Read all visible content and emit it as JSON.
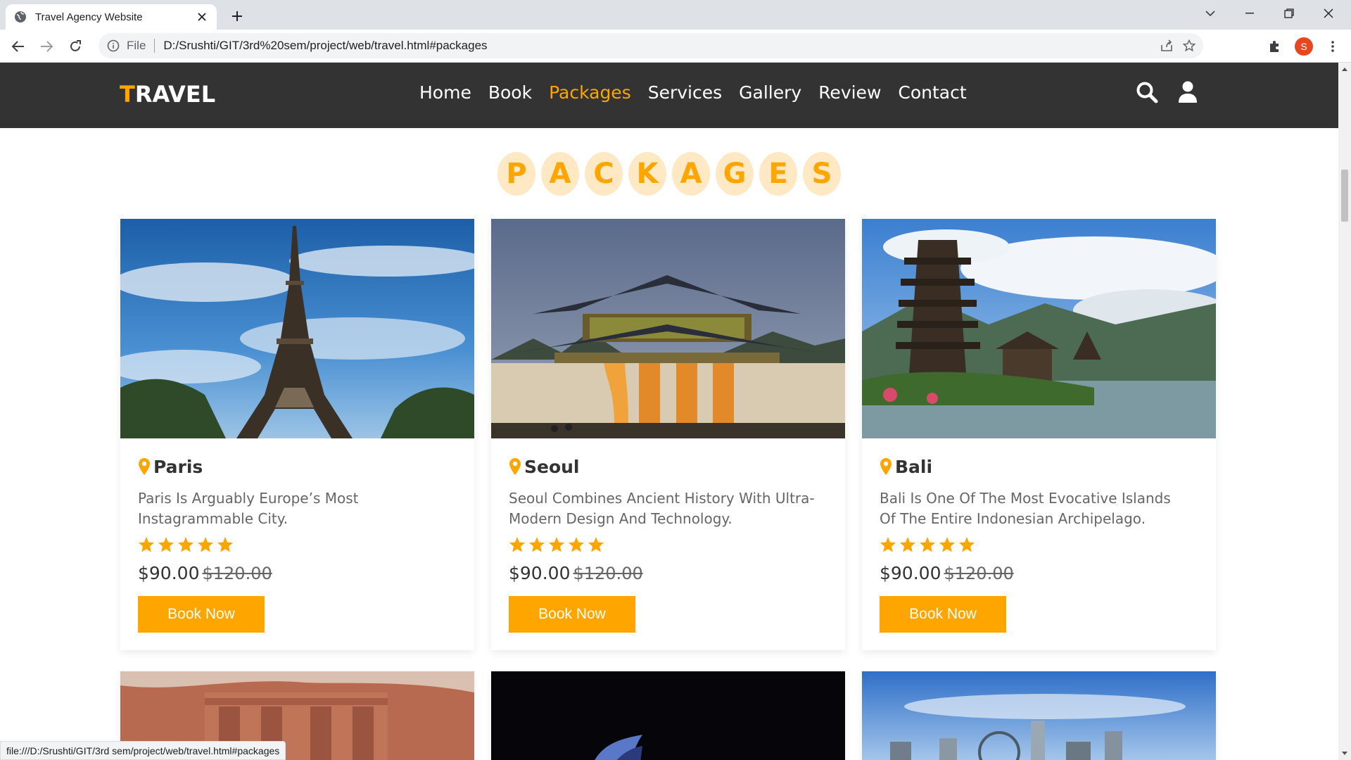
{
  "browser": {
    "tab_title": "Travel Agency Website",
    "url_scheme": "File",
    "url": "D:/Srushti/GIT/3rd%20sem/project/web/travel.html#packages",
    "profile_initial": "S",
    "status_url": "file:///D:/Srushti/GIT/3rd sem/project/web/travel.html#packages"
  },
  "site": {
    "logo_first": "T",
    "logo_rest": "RAVEL",
    "nav": [
      {
        "label": "Home",
        "active": false
      },
      {
        "label": "Book",
        "active": false
      },
      {
        "label": "Packages",
        "active": true
      },
      {
        "label": "Services",
        "active": false
      },
      {
        "label": "Gallery",
        "active": false
      },
      {
        "label": "Review",
        "active": false
      },
      {
        "label": "Contact",
        "active": false
      }
    ],
    "heading_letters": [
      "P",
      "A",
      "C",
      "K",
      "A",
      "G",
      "E",
      "S"
    ],
    "accent_color": "#ffa500",
    "nav_bg_color": "#333333"
  },
  "packages": [
    {
      "name": "Paris",
      "desc": "Paris Is Arguably Europe’s Most Instagrammable City.",
      "rating": 5,
      "price": "$90.00",
      "old_price": "$120.00",
      "button": "Book Now",
      "image": "eiffel-tower-photo"
    },
    {
      "name": "Seoul",
      "desc": "Seoul Combines Ancient History With Ultra-Modern Design And Technology.",
      "rating": 5,
      "price": "$90.00",
      "old_price": "$120.00",
      "button": "Book Now",
      "image": "gyeongbokgung-gate-photo"
    },
    {
      "name": "Bali",
      "desc": "Bali Is One Of The Most Evocative Islands Of The Entire Indonesian Archipelago.",
      "rating": 5,
      "price": "$90.00",
      "old_price": "$120.00",
      "button": "Book Now",
      "image": "bali-temple-photo"
    }
  ],
  "packages_row2_images": [
    "petra-photo",
    "sydney-opera-house-photo",
    "city-skyline-photo"
  ]
}
